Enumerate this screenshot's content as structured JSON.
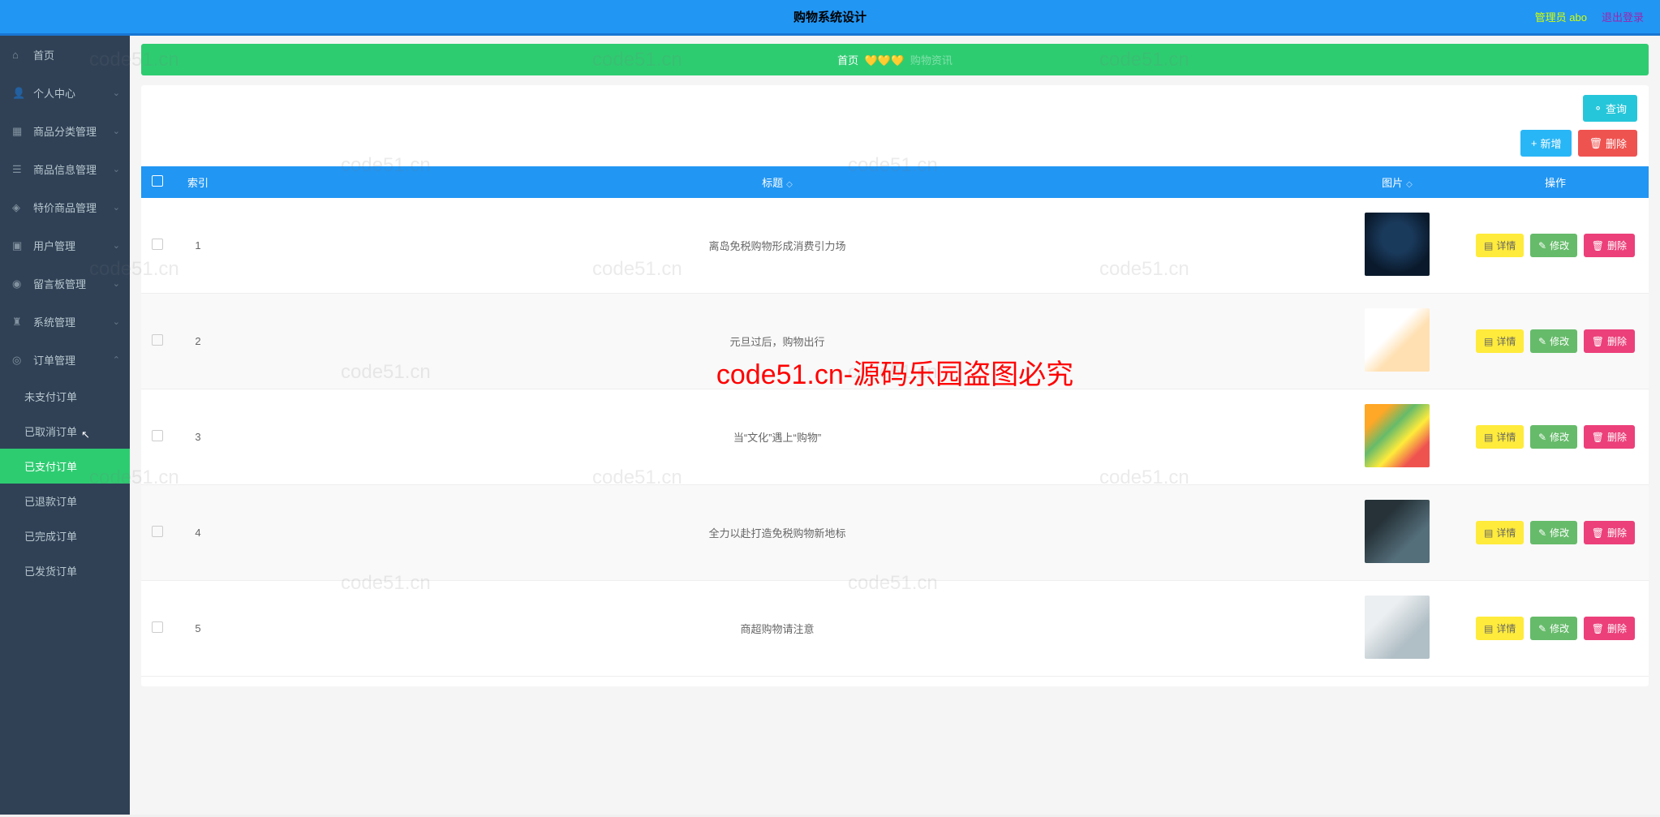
{
  "header": {
    "title": "购物系统设计",
    "user": "管理员 abo",
    "logout": "退出登录"
  },
  "sidebar": {
    "items": [
      {
        "icon": "home",
        "label": "首页",
        "hasSubmenu": false
      },
      {
        "icon": "user",
        "label": "个人中心",
        "hasSubmenu": true
      },
      {
        "icon": "grid",
        "label": "商品分类管理",
        "hasSubmenu": true
      },
      {
        "icon": "list",
        "label": "商品信息管理",
        "hasSubmenu": true
      },
      {
        "icon": "tag",
        "label": "特价商品管理",
        "hasSubmenu": true
      },
      {
        "icon": "users",
        "label": "用户管理",
        "hasSubmenu": true
      },
      {
        "icon": "message",
        "label": "留言板管理",
        "hasSubmenu": true
      },
      {
        "icon": "settings",
        "label": "系统管理",
        "hasSubmenu": true
      },
      {
        "icon": "order",
        "label": "订单管理",
        "hasSubmenu": true,
        "expanded": true
      }
    ],
    "subitems": [
      {
        "label": "未支付订单",
        "active": false
      },
      {
        "label": "已取消订单",
        "active": false
      },
      {
        "label": "已支付订单",
        "active": true
      },
      {
        "label": "已退款订单",
        "active": false
      },
      {
        "label": "已完成订单",
        "active": false
      },
      {
        "label": "已发货订单",
        "active": false
      }
    ]
  },
  "breadcrumb": {
    "home": "首页",
    "hearts": "💛💛💛",
    "current": "购物资讯"
  },
  "toolbar": {
    "search": "查询",
    "add": "新增",
    "delete": "删除"
  },
  "table": {
    "headers": {
      "index": "索引",
      "title": "标题",
      "image": "图片",
      "action": "操作"
    },
    "actions": {
      "detail": "详情",
      "edit": "修改",
      "delete": "删除"
    },
    "rows": [
      {
        "index": "1",
        "title": "离岛免税购物形成消费引力场"
      },
      {
        "index": "2",
        "title": "元旦过后，购物出行"
      },
      {
        "index": "3",
        "title": "当“文化”遇上“购物”"
      },
      {
        "index": "4",
        "title": "全力以赴打造免税购物新地标"
      },
      {
        "index": "5",
        "title": "商超购物请注意"
      }
    ]
  },
  "watermarks": {
    "text": "code51.cn",
    "center": "code51.cn-源码乐园盗图必究"
  }
}
